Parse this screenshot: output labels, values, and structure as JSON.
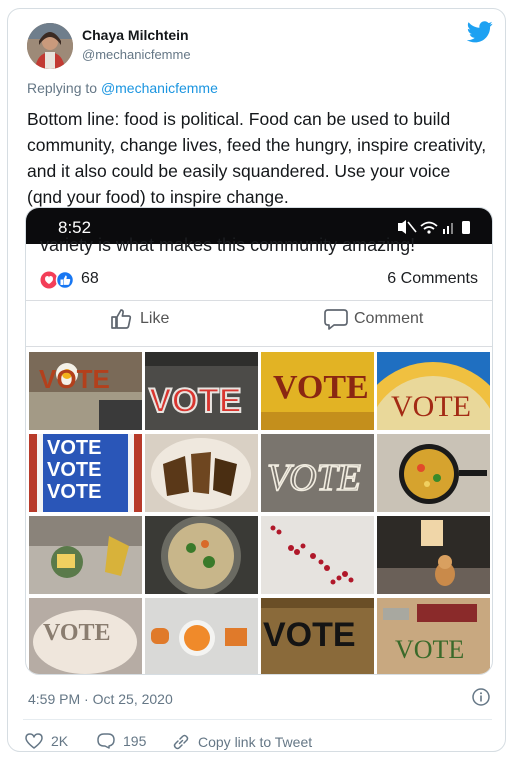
{
  "tweet": {
    "author_name": "Chaya Milchtein",
    "author_handle": "@mechanicfemme",
    "replying_prefix": "Replying to ",
    "replying_to": "@mechanicfemme",
    "text": "Bottom line: food is political. Food can be used to build community, change lives, feed the hungry, inspire creativity, and it also could be easily squandered. Use your voice (qnd your food) to inspire change.",
    "timestamp": "4:59 PM · Oct 25, 2020",
    "likes": "2K",
    "replies": "195",
    "copy_link_label": "Copy link to Tweet"
  },
  "embedded": {
    "phone_time": "8:52",
    "cut_caption": "variety is what makes this community amazing!",
    "reaction_count": "68",
    "comments_label": "6 Comments",
    "like_label": "Like",
    "comment_label": "Comment",
    "tile_words": [
      "VOTE",
      "VOTE",
      "VOTE",
      "VOTE",
      "VOTE",
      "VOTE",
      "VOTE",
      "VOTE",
      "VOTE",
      "VOTE",
      "VOTE"
    ]
  },
  "colors": {
    "twitter_blue": "#1da1f2",
    "link_blue": "#1b95e0",
    "muted": "#657786"
  }
}
